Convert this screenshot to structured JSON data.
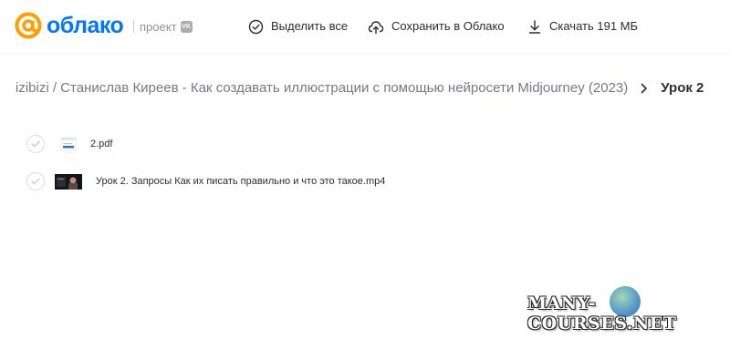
{
  "header": {
    "logo_text": "облако",
    "logo_icon": "at-sign-logo-icon",
    "project_label": "проект",
    "vk_badge": "VK",
    "select_all": "Выделить все",
    "save_to_cloud": "Сохранить в Облако",
    "download": "Скачать 191 МБ",
    "brand_color": "#0077ff",
    "logo_orange": "#ff9e00"
  },
  "breadcrumb": {
    "path": "izibizi / Станислав Киреев - Как создавать иллюстрации с помощью нейросети Midjourney (2023)",
    "current": "Урок 2"
  },
  "files": [
    {
      "name": "2.pdf",
      "icon": "pdf-thumbnail"
    },
    {
      "name": "Урок 2. Запросы Как их писать правильно и что это такое.mp4",
      "icon": "video-thumbnail"
    }
  ],
  "watermark": {
    "text": "MANY-COURSES.NET"
  }
}
